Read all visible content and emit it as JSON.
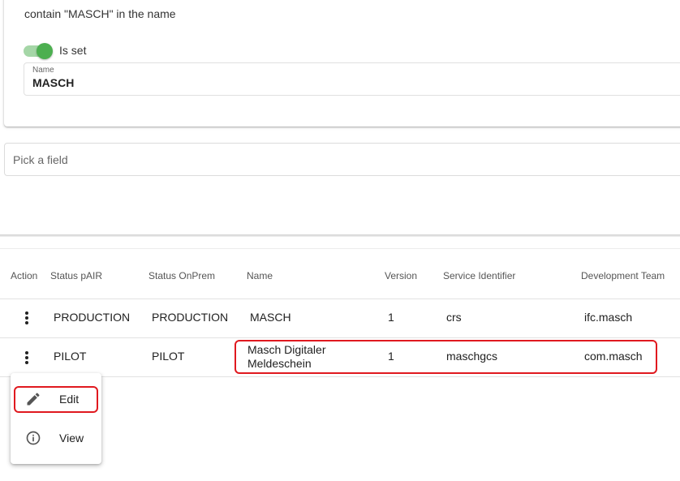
{
  "filter": {
    "description": "contain \"MASCH\" in the name",
    "toggle_label": "Is set",
    "name_field_label": "Name",
    "name_field_value": "MASCH"
  },
  "pick_field": {
    "placeholder": "Pick a field"
  },
  "table": {
    "headers": {
      "action": "Action",
      "status_pair": "Status pAIR",
      "status_onprem": "Status OnPrem",
      "name": "Name",
      "version": "Version",
      "service_identifier": "Service Identifier",
      "development_team": "Development Team"
    },
    "rows": [
      {
        "status_pair": "PRODUCTION",
        "status_onprem": "PRODUCTION",
        "name": "MASCH",
        "version": "1",
        "service_identifier": "crs",
        "development_team": "ifc.masch"
      },
      {
        "status_pair": "PILOT",
        "status_onprem": "PILOT",
        "name_line1": "Masch Digitaler",
        "name_line2": "Meldeschein",
        "version": "1",
        "service_identifier": "maschgcs",
        "development_team": "com.masch"
      }
    ]
  },
  "context_menu": {
    "items": [
      {
        "label": "Edit",
        "icon": "pencil-icon"
      },
      {
        "label": "View",
        "icon": "info-icon"
      }
    ]
  },
  "colors": {
    "toggle_on": "#4caf50",
    "toggle_track": "#a5d6a7",
    "highlight": "#e0191f"
  }
}
